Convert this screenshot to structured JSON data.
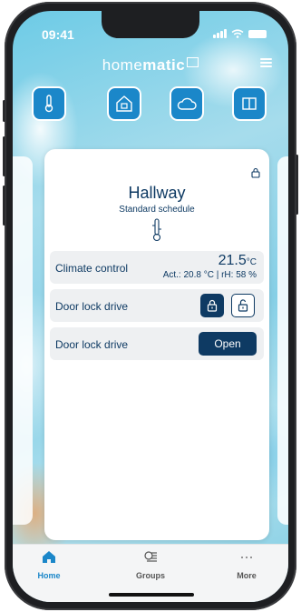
{
  "status_bar": {
    "time": "09:41"
  },
  "app": {
    "brand_light": "home",
    "brand_bold": "matic"
  },
  "categories": [
    {
      "icon": "thermometer-icon"
    },
    {
      "icon": "door-lock-icon"
    },
    {
      "icon": "cloud-icon"
    },
    {
      "icon": "window-icon"
    }
  ],
  "room": {
    "title": "Hallway",
    "subtitle": "Standard schedule"
  },
  "rows": {
    "climate": {
      "label": "Climate control",
      "value": "21.5",
      "unit": "°C",
      "detail": "Act.: 20.8 °C | rH: 58 %"
    },
    "lock": {
      "label": "Door lock drive"
    },
    "open": {
      "label": "Door lock drive",
      "button": "Open"
    }
  },
  "nav": {
    "home": "Home",
    "groups": "Groups",
    "more": "More"
  },
  "colors": {
    "accent": "#1b87c9",
    "primary_dark": "#0e3a63"
  }
}
